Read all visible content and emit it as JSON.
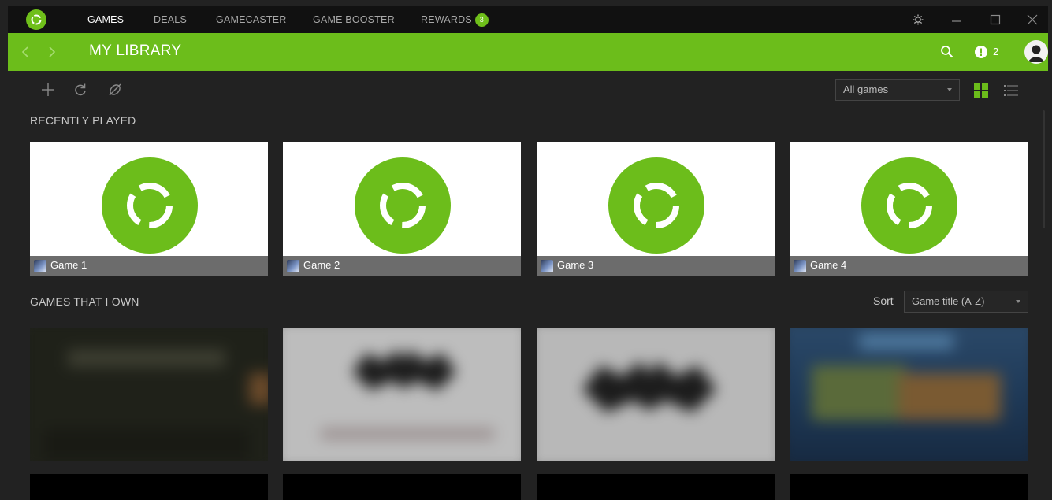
{
  "titlebar": {
    "nav": [
      {
        "label": "GAMES",
        "active": true
      },
      {
        "label": "DEALS",
        "active": false
      },
      {
        "label": "GAMECASTER",
        "active": false
      },
      {
        "label": "GAME BOOSTER",
        "active": false
      },
      {
        "label": "REWARDS",
        "active": false,
        "badge": "3"
      }
    ],
    "window_icons": [
      "settings-icon",
      "minimize-icon",
      "maximize-icon",
      "close-icon"
    ]
  },
  "header": {
    "title": "MY LIBRARY",
    "notification_count": "2",
    "icons": [
      "back-icon",
      "forward-icon",
      "search-icon",
      "alert-icon",
      "avatar"
    ]
  },
  "toolbar": {
    "icons": [
      "add-icon",
      "refresh-icon",
      "hide-icon"
    ],
    "filter": {
      "value": "All games"
    },
    "view_modes": [
      "grid-view-icon",
      "list-view-icon"
    ]
  },
  "recently_played": {
    "title": "RECENTLY PLAYED",
    "games": [
      {
        "name": "Game 1"
      },
      {
        "name": "Game 2"
      },
      {
        "name": "Game 3"
      },
      {
        "name": "Game 4"
      }
    ]
  },
  "owned": {
    "title": "GAMES THAT I OWN",
    "sort_label": "Sort",
    "sort_value": "Game title (A-Z)"
  },
  "colors": {
    "accent": "#6cbd1b",
    "titlebar": "#111111",
    "background": "#222222",
    "card_footer": "#6c6c6c"
  }
}
